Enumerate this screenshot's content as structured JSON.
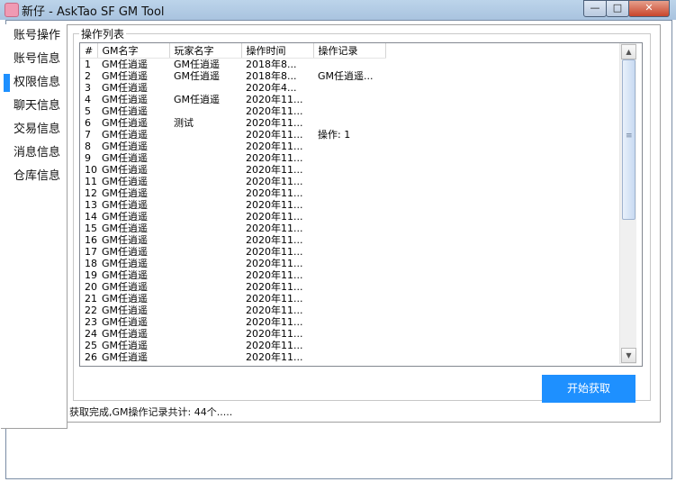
{
  "window": {
    "title": "新仔 - AskTao SF GM Tool",
    "min": "—",
    "max": "□",
    "close": "✕"
  },
  "sidebar": {
    "items": [
      {
        "label": "账号操作"
      },
      {
        "label": "账号信息"
      },
      {
        "label": "权限信息",
        "active": true
      },
      {
        "label": "聊天信息"
      },
      {
        "label": "交易信息"
      },
      {
        "label": "消息信息"
      },
      {
        "label": "仓库信息"
      }
    ]
  },
  "group": {
    "title": "操作列表"
  },
  "table": {
    "columns": [
      "#",
      "GM名字",
      "玩家名字",
      "操作时间",
      "操作记录"
    ],
    "rows": [
      [
        "1",
        "GM任逍遥",
        "GM任逍遥",
        "2018年8...",
        ""
      ],
      [
        "2",
        "GM任逍遥",
        "GM任逍遥",
        "2018年8...",
        "GM任逍遥..."
      ],
      [
        "3",
        "GM任逍遥",
        "",
        "2020年4...",
        ""
      ],
      [
        "4",
        "GM任逍遥",
        "GM任逍遥",
        "2020年11...",
        ""
      ],
      [
        "5",
        "GM任逍遥",
        "",
        "2020年11...",
        ""
      ],
      [
        "6",
        "GM任逍遥",
        "测试",
        "2020年11...",
        ""
      ],
      [
        "7",
        "GM任逍遥",
        "",
        "2020年11...",
        "操作: 1"
      ],
      [
        "8",
        "GM任逍遥",
        "",
        "2020年11...",
        ""
      ],
      [
        "9",
        "GM任逍遥",
        "",
        "2020年11...",
        ""
      ],
      [
        "10",
        "GM任逍遥",
        "",
        "2020年11...",
        ""
      ],
      [
        "11",
        "GM任逍遥",
        "",
        "2020年11...",
        ""
      ],
      [
        "12",
        "GM任逍遥",
        "",
        "2020年11...",
        ""
      ],
      [
        "13",
        "GM任逍遥",
        "",
        "2020年11...",
        ""
      ],
      [
        "14",
        "GM任逍遥",
        "",
        "2020年11...",
        ""
      ],
      [
        "15",
        "GM任逍遥",
        "",
        "2020年11...",
        ""
      ],
      [
        "16",
        "GM任逍遥",
        "",
        "2020年11...",
        ""
      ],
      [
        "17",
        "GM任逍遥",
        "",
        "2020年11...",
        ""
      ],
      [
        "18",
        "GM任逍遥",
        "",
        "2020年11...",
        ""
      ],
      [
        "19",
        "GM任逍遥",
        "",
        "2020年11...",
        ""
      ],
      [
        "20",
        "GM任逍遥",
        "",
        "2020年11...",
        ""
      ],
      [
        "21",
        "GM任逍遥",
        "",
        "2020年11...",
        ""
      ],
      [
        "22",
        "GM任逍遥",
        "",
        "2020年11...",
        ""
      ],
      [
        "23",
        "GM任逍遥",
        "",
        "2020年11...",
        ""
      ],
      [
        "24",
        "GM任逍遥",
        "",
        "2020年11...",
        ""
      ],
      [
        "25",
        "GM任逍遥",
        "",
        "2020年11...",
        ""
      ],
      [
        "26",
        "GM任逍遥",
        "",
        "2020年11...",
        ""
      ]
    ]
  },
  "scrollbar": {
    "up": "▲",
    "down": "▼",
    "grip": "≡"
  },
  "fetch_button": {
    "label": "开始获取"
  },
  "status": {
    "text": "获取完成,GM操作记录共计: 44个....."
  },
  "colors": {
    "accent": "#1e90ff"
  }
}
